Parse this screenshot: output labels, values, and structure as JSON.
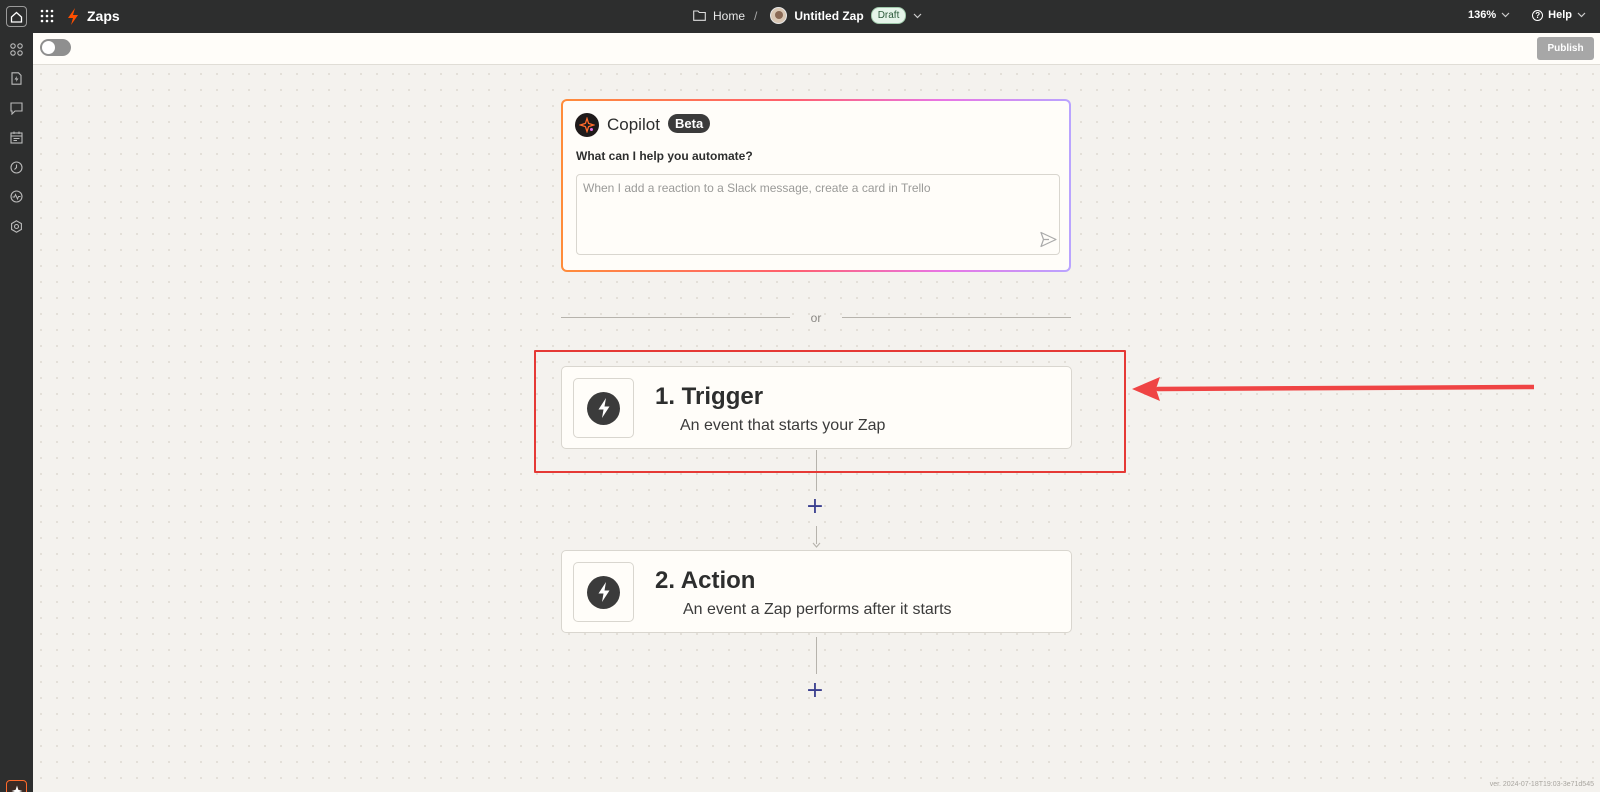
{
  "topbar": {
    "app_title": "Zaps",
    "breadcrumb_home": "Home",
    "breadcrumb_separator": "/",
    "zap_name": "Untitled Zap",
    "status_badge": "Draft",
    "zoom": "136%",
    "help": "Help"
  },
  "subbar": {
    "publish_label": "Publish",
    "toggle_on": false
  },
  "sidebar": {
    "items": [
      {
        "icon": "apps-icon"
      },
      {
        "icon": "zap-file-icon"
      },
      {
        "icon": "chat-icon"
      },
      {
        "icon": "calendar-icon"
      },
      {
        "icon": "history-icon"
      },
      {
        "icon": "activity-icon"
      },
      {
        "icon": "settings-icon"
      }
    ],
    "bottom_icon": "copilot-sparkle-icon"
  },
  "copilot": {
    "title": "Copilot",
    "badge": "Beta",
    "question": "What can I help you automate?",
    "input_placeholder": "When I add a reaction to a Slack message, create a card in Trello",
    "input_value": ""
  },
  "divider": {
    "label": "or"
  },
  "steps": [
    {
      "title": "1. Trigger",
      "subtitle": "An event that starts your Zap",
      "icon": "bolt-icon"
    },
    {
      "title": "2. Action",
      "subtitle": "An event a Zap performs after it starts",
      "icon": "bolt-icon"
    }
  ],
  "footer": {
    "version": "ver. 2024-07-18T19:03-3e71d545"
  },
  "colors": {
    "topbar_bg": "#2d2e2e",
    "brand_orange": "#ff4f00",
    "annotation_red": "#e53935",
    "plus_blue": "#3a3f8f"
  }
}
